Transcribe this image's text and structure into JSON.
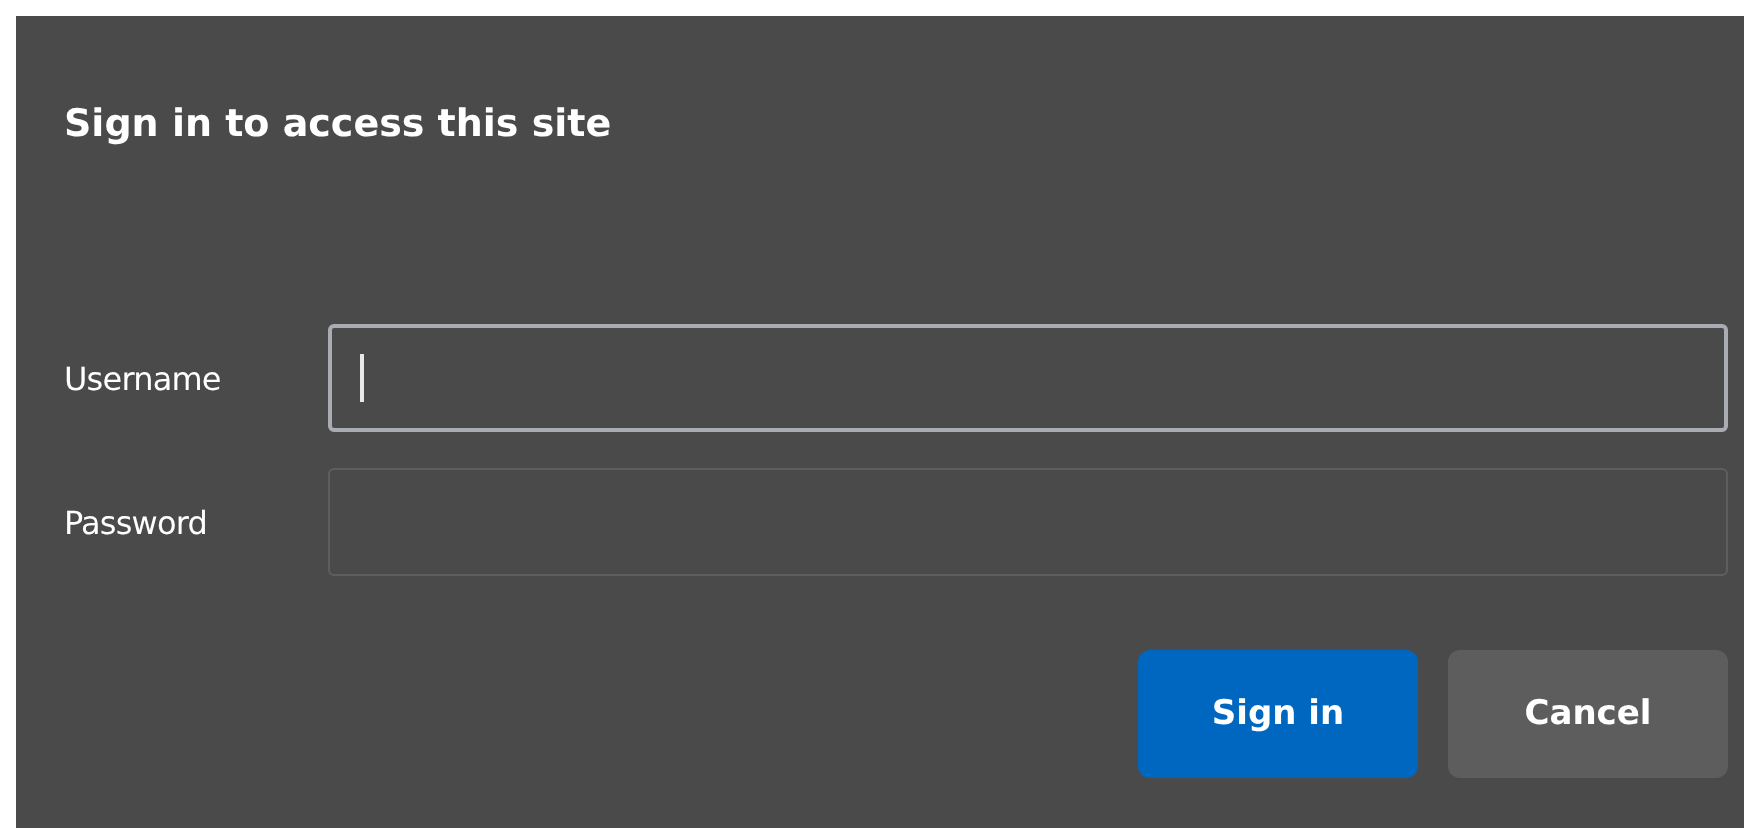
{
  "dialog": {
    "title": "Sign in to access this site"
  },
  "fields": [
    {
      "label": "Username",
      "focused": true
    },
    {
      "label": "Password",
      "focused": false
    }
  ],
  "buttons": [
    {
      "label": "Sign in",
      "kind": "primary"
    },
    {
      "label": "Cancel",
      "kind": "secondary"
    }
  ]
}
